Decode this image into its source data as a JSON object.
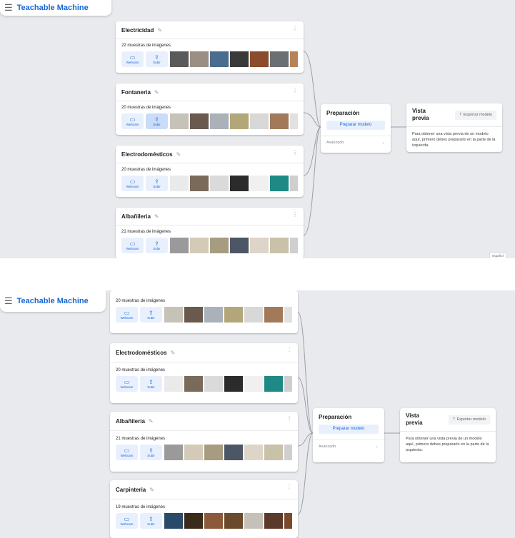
{
  "app": {
    "brand": "Teachable Machine",
    "language": "español"
  },
  "classes": [
    {
      "name": "Electricidad",
      "count": "22 muestras de imágenes"
    },
    {
      "name": "Fontaneria",
      "count": "20 muestras de imágenes"
    },
    {
      "name": "Electrodomésticos",
      "count": "20 muestras de imágenes"
    },
    {
      "name": "Albañileria",
      "count": "21 muestras de imágenes"
    },
    {
      "name": "Carpinteria",
      "count": "19 muestras de imágenes"
    }
  ],
  "buttons": {
    "webcam": "Webcam",
    "upload": "Subir"
  },
  "training": {
    "title": "Preparación",
    "button": "Preparar modelo",
    "advanced": "Avanzado"
  },
  "preview": {
    "title": "Vista previa",
    "export": "Exportar modelo",
    "text": "Para obtener una vista previa de un modelo aquí, primero debes prepararlo en la parte de la izquierda."
  },
  "icons": {
    "menu": "hamburger-icon",
    "edit": "pencil-icon",
    "more": "kebab-icon",
    "webcam": "video-camera-icon",
    "upload": "upload-icon",
    "chevron": "chevron-down-icon",
    "export": "export-icon"
  },
  "colors": {
    "brand": "#1967d2",
    "button_bg": "#e8f0fe",
    "canvas_bg": "#e8eaed"
  },
  "thumbnail_colors": {
    "electricidad": [
      "#5a5a5a",
      "#9a8f82",
      "#4a6d8f",
      "#3a3a3a",
      "#8c4b2c",
      "#6a6f74",
      "#b58358"
    ],
    "fontaneria": [
      "#c7c2b7",
      "#6a5a4d",
      "#aab1b9",
      "#b3a679",
      "#d8d8d8",
      "#a27a5a",
      "#e1e1e1"
    ],
    "electrodomesticos": [
      "#eaeaea",
      "#7a6a5a",
      "#dadada",
      "#2b2b2b",
      "#f0f0f0",
      "#1f8a85",
      "#cfcfcf"
    ],
    "albanileria": [
      "#9a9a9a",
      "#d3cbb8",
      "#a89c80",
      "#4c5666",
      "#ddd6c8",
      "#c9c1a8",
      "#cfcfcf"
    ],
    "carpinteria": [
      "#2a4a6a",
      "#3a2a1a",
      "#8a5a3a",
      "#6a4a2a",
      "#c6c1b8",
      "#5a3a2a",
      "#7a4a2a"
    ]
  }
}
